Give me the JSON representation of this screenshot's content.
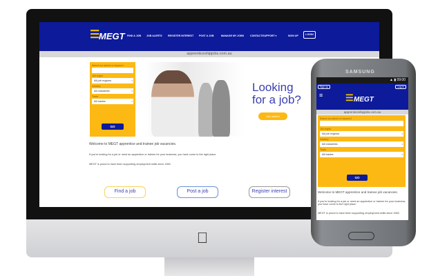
{
  "site": {
    "brand": "MEGT",
    "url": "apprenticeshipjobs.com.au"
  },
  "nav": {
    "items": [
      "FIND A JOB",
      "JOB ALERTS",
      "REGISTER INTEREST",
      "POST A JOB",
      "MANAGE MY JOBS",
      "CONTACT/SUPPORT ▾",
      "SIGN UP"
    ],
    "login": "LOGIN"
  },
  "search": {
    "keyword_label": "Search by suburb or keyword",
    "keyword_value": "",
    "region_label": "Job region",
    "region_value": "All job regions",
    "industry_label": "Industry",
    "industry_value": "All industries",
    "trade_label": "Trade",
    "trade_value": "All trades",
    "go": "GO"
  },
  "hero": {
    "headline_1": "Looking",
    "headline_2": "for a job?",
    "button": "Job search"
  },
  "content": {
    "welcome": "Welcome to MEGT apprentice and trainee job vacancies.",
    "p1": "If you're looking for a job or need an apprentice or trainee for your business, you have come to the right place.",
    "p2": "MEGT is proud to have been supporting employment skills since 1982."
  },
  "cta": {
    "find": "Find a job",
    "post": "Post a job",
    "register": "Register interest"
  },
  "phone": {
    "brand": "SAMSUNG",
    "time": "09:00",
    "signup": "Sign up",
    "login": "Log in"
  },
  "colors": {
    "brand_blue": "#0d1a9a",
    "brand_yellow": "#fdb913"
  }
}
